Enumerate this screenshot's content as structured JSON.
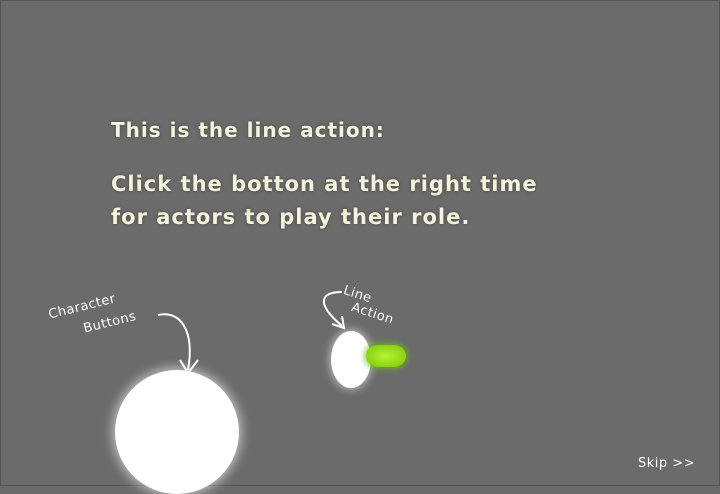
{
  "tutorial": {
    "title": "This is the line action:",
    "instruction_line1": "Click the botton at the right time",
    "instruction_line2": "for actors to play their role."
  },
  "labels": {
    "character_line1": "Character",
    "character_line2": "Buttons",
    "line_line1": "Line",
    "line_line2": "Action"
  },
  "nav": {
    "skip_label": "Skip >>"
  },
  "colors": {
    "background": "#6b6b6b",
    "text": "#f4f4dc",
    "line_button": "#8cd412"
  },
  "icons": {
    "character_arrow": "curved-arrow-icon",
    "line_arrow": "curved-arrow-icon"
  }
}
